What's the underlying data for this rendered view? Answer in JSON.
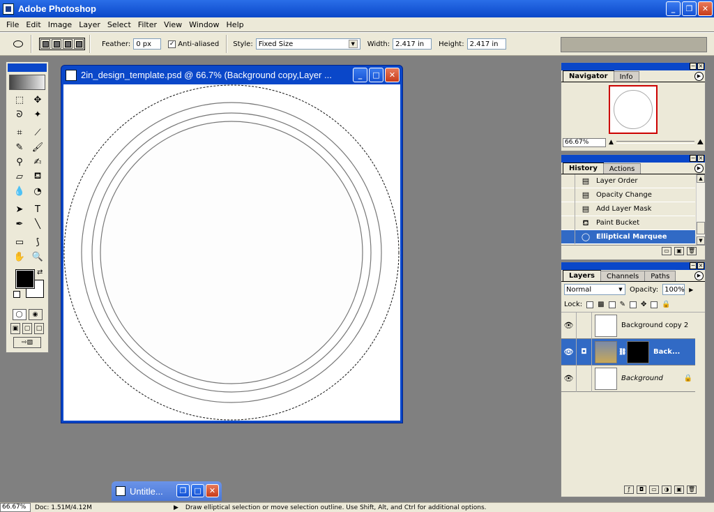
{
  "app": {
    "title": "Adobe Photoshop",
    "window_buttons": {
      "minimize": "_",
      "maximize": "❐",
      "close": "✕"
    }
  },
  "menu": [
    "File",
    "Edit",
    "Image",
    "Layer",
    "Select",
    "Filter",
    "View",
    "Window",
    "Help"
  ],
  "options": {
    "feather_label": "Feather:",
    "feather_value": "0 px",
    "antialias_label": "Anti-aliased",
    "antialias_checked": "✓",
    "style_label": "Style:",
    "style_value": "Fixed Size",
    "width_label": "Width:",
    "width_value": "2.417 in",
    "height_label": "Height:",
    "height_value": "2.417 in"
  },
  "toolbox": {
    "tools": [
      {
        "name": "rect-marquee-icon",
        "glyph": "⬚"
      },
      {
        "name": "move-icon",
        "glyph": "✥"
      },
      {
        "name": "lasso-icon",
        "glyph": "ᘐ"
      },
      {
        "name": "magic-wand-icon",
        "glyph": "✦"
      },
      {
        "name": "crop-icon",
        "glyph": "⌗"
      },
      {
        "name": "slice-icon",
        "glyph": "⟋"
      },
      {
        "name": "healing-brush-icon",
        "glyph": "✎"
      },
      {
        "name": "brush-icon",
        "glyph": "🖌"
      },
      {
        "name": "clone-stamp-icon",
        "glyph": "⚲"
      },
      {
        "name": "history-brush-icon",
        "glyph": "✍"
      },
      {
        "name": "eraser-icon",
        "glyph": "▱"
      },
      {
        "name": "paint-bucket-icon",
        "glyph": "⛾"
      },
      {
        "name": "blur-icon",
        "glyph": "💧"
      },
      {
        "name": "dodge-icon",
        "glyph": "◔"
      },
      {
        "name": "path-select-icon",
        "glyph": "➤"
      },
      {
        "name": "type-icon",
        "glyph": "T"
      },
      {
        "name": "pen-icon",
        "glyph": "✒"
      },
      {
        "name": "line-icon",
        "glyph": "╲"
      },
      {
        "name": "notes-icon",
        "glyph": "▭"
      },
      {
        "name": "eyedropper-icon",
        "glyph": "⟆"
      },
      {
        "name": "hand-icon",
        "glyph": "✋"
      },
      {
        "name": "zoom-icon",
        "glyph": "🔍"
      }
    ]
  },
  "document": {
    "title": "2in_design_template.psd @ 66.7% (Background copy,Layer ..."
  },
  "minimized": {
    "title": "Untitle..."
  },
  "status": {
    "zoom": "66.67%",
    "doc": "Doc: 1.51M/4.12M",
    "arrow": "▶",
    "hint": "Draw elliptical selection or move selection outline.  Use Shift, Alt, and Ctrl for additional options."
  },
  "navigator": {
    "tabs": [
      "Navigator",
      "Info"
    ],
    "zoom": "66.67%"
  },
  "history": {
    "tabs": [
      "History",
      "Actions"
    ],
    "items": [
      {
        "label": "Layer Order",
        "icon": "▤"
      },
      {
        "label": "Opacity Change",
        "icon": "▤"
      },
      {
        "label": "Add Layer Mask",
        "icon": "▤"
      },
      {
        "label": "Paint Bucket",
        "icon": "⛾"
      },
      {
        "label": "Elliptical Marquee",
        "icon": "◯"
      }
    ]
  },
  "layers": {
    "tabs": [
      "Layers",
      "Channels",
      "Paths"
    ],
    "blend_mode": "Normal",
    "opacity_label": "Opacity:",
    "opacity_value": "100%",
    "lock_label": "Lock:",
    "items": [
      {
        "name": "Background copy 2",
        "eye": "👁"
      },
      {
        "name": "Back...",
        "eye": "👁"
      },
      {
        "name": "Background",
        "eye": "👁",
        "lock": "🔒"
      }
    ]
  }
}
